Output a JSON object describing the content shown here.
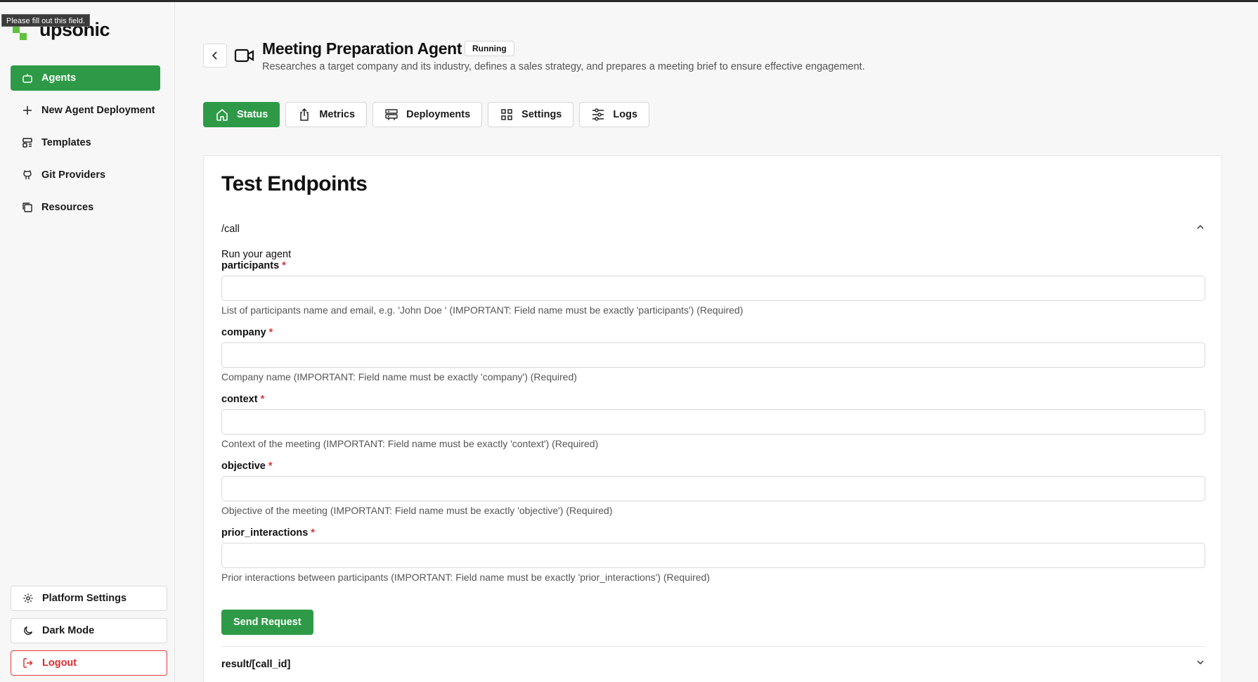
{
  "tooltip": "Please fill out this field.",
  "brand": {
    "name": "upsonic",
    "accent": "#5ec33b"
  },
  "sidebar": {
    "items": [
      {
        "label": "Agents",
        "icon": "bot-icon",
        "active": true
      },
      {
        "label": "New Agent Deployment",
        "icon": "plus-icon"
      },
      {
        "label": "Templates",
        "icon": "template-icon"
      },
      {
        "label": "Git Providers",
        "icon": "github-icon"
      },
      {
        "label": "Resources",
        "icon": "resources-icon"
      }
    ],
    "bottom": {
      "platform_settings": "Platform Settings",
      "dark_mode": "Dark Mode",
      "logout": "Logout"
    }
  },
  "header": {
    "title": "Meeting Preparation Agent",
    "status": "Running",
    "subtitle": "Researches a target company and its industry, defines a sales strategy, and prepares a meeting brief to ensure effective engagement."
  },
  "tabs": [
    {
      "label": "Status",
      "icon": "home-icon",
      "active": true
    },
    {
      "label": "Metrics",
      "icon": "share-icon"
    },
    {
      "label": "Deployments",
      "icon": "server-icon"
    },
    {
      "label": "Settings",
      "icon": "grid-icon"
    },
    {
      "label": "Logs",
      "icon": "sliders-icon"
    }
  ],
  "panel": {
    "title": "Test Endpoints",
    "endpoint": "/call",
    "run_text": "Run your agent",
    "fields": [
      {
        "name": "participants",
        "value": "",
        "help": "List of participants name and email, e.g. 'John Doe ' (IMPORTANT: Field name must be exactly 'participants') (Required)"
      },
      {
        "name": "company",
        "value": "",
        "help": "Company name (IMPORTANT: Field name must be exactly 'company') (Required)"
      },
      {
        "name": "context",
        "value": "",
        "help": "Context of the meeting (IMPORTANT: Field name must be exactly 'context') (Required)"
      },
      {
        "name": "objective",
        "value": "",
        "help": "Objective of the meeting (IMPORTANT: Field name must be exactly 'objective') (Required)"
      },
      {
        "name": "prior_interactions",
        "value": "",
        "help": "Prior interactions between participants (IMPORTANT: Field name must be exactly 'prior_interactions') (Required)"
      }
    ],
    "required_mark": "*",
    "send_button": "Send Request",
    "result_endpoint": "result/[call_id]"
  },
  "colors": {
    "primary": "#2e9a47",
    "danger": "#e03131"
  }
}
